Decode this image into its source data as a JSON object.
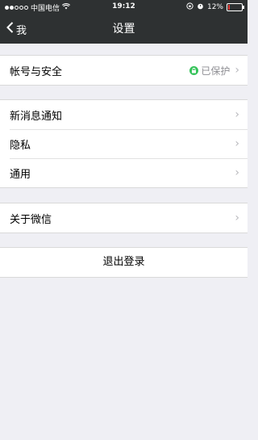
{
  "status_bar": {
    "carrier": "中国电信",
    "time": "19:12",
    "battery": "12%",
    "battery_level": 0.12,
    "icons": [
      "signal-dots-icon",
      "wifi-icon",
      "lock-rotation-icon",
      "alarm-icon",
      "battery-icon"
    ]
  },
  "nav": {
    "back_label": "我",
    "title": "设置"
  },
  "sections": {
    "account": {
      "label": "帐号与安全",
      "status": "已保护"
    },
    "notifications": {
      "label": "新消息通知"
    },
    "privacy": {
      "label": "隐私"
    },
    "general": {
      "label": "通用"
    },
    "about": {
      "label": "关于微信"
    }
  },
  "logout": {
    "label": "退出登录"
  },
  "colors": {
    "nav_bg": "#2e3132",
    "page_bg": "#efeff4",
    "protect_green": "#35c35a"
  }
}
